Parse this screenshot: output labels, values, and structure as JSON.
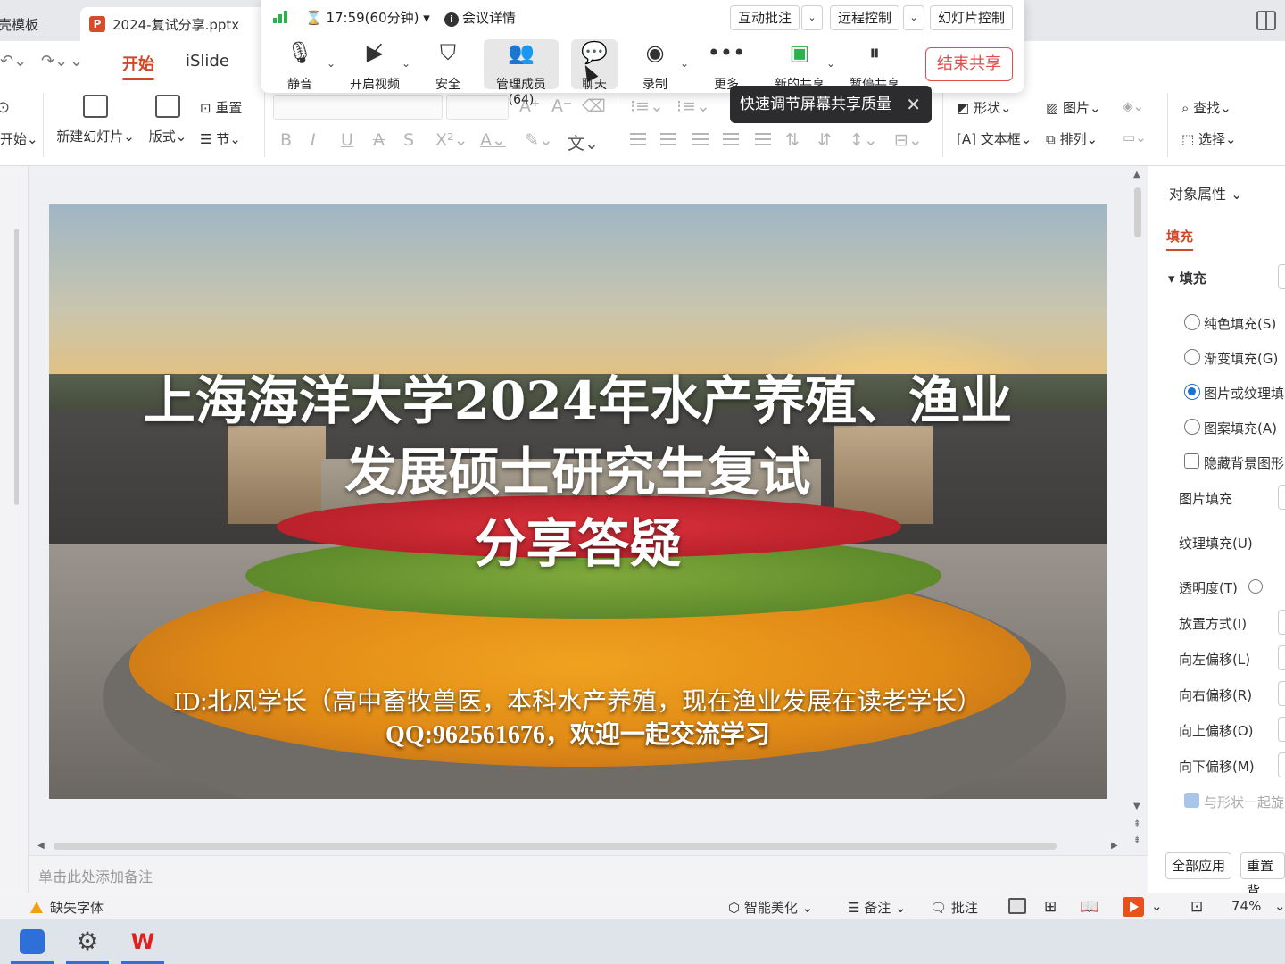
{
  "tabs": [
    {
      "label": "壳模板"
    },
    {
      "label": "2024-复试分享.pptx",
      "badge": "P"
    }
  ],
  "menu": {
    "start": "开始",
    "islide": "iSlide"
  },
  "ribbon": {
    "reset_slide": "重置",
    "start_dropdown": "开始",
    "new_slide": "新建幻灯片",
    "layout": "版式",
    "section": "节",
    "shape": "形状",
    "picture": "图片",
    "textbox": "文本框",
    "arrange": "排列",
    "find": "查找",
    "select": "选择"
  },
  "meeting": {
    "time": "17:59(60分钟)",
    "info": "会议详情",
    "interactive_annotation": "互动批注",
    "remote_control": "远程控制",
    "slide_control": "幻灯片控制",
    "mute": "静音",
    "video": "开启视频",
    "security": "安全",
    "members": "管理成员(64)",
    "chat": "聊天",
    "record": "录制",
    "more": "更多",
    "new_share": "新的共享",
    "pause_share": "暂停共享",
    "end_share": "结束共享",
    "tooltip": "快速调节屏幕共享质量",
    "accent_color": "#2bb24c",
    "end_color": "#e34b4b"
  },
  "slide": {
    "title_line1": "上海海洋大学2024年水产养殖、渔业",
    "title_line2": "发展硕士研究生复试",
    "title_line3": "分享答疑",
    "subtitle_line1": "ID:北风学长（高中畜牧兽医，本科水产养殖，现在渔业发展在读老学长）",
    "subtitle_line2": "QQ:962561676，欢迎一起交流学习"
  },
  "notes_placeholder": "单击此处添加备注",
  "panel": {
    "title": "对象属性",
    "tab_fill": "填充",
    "section_fill": "填充",
    "options": [
      {
        "label": "纯色填充(S)",
        "selected": false
      },
      {
        "label": "渐变填充(G)",
        "selected": false
      },
      {
        "label": "图片或纹理填",
        "selected": true
      },
      {
        "label": "图案填充(A)",
        "selected": false
      }
    ],
    "hide_bg": "隐藏背景图形",
    "picture_fill": "图片填充",
    "texture_fill": "纹理填充(U)",
    "transparency": "透明度(T)",
    "placement": "放置方式(I)",
    "offset_left": "向左偏移(L)",
    "offset_right": "向右偏移(R)",
    "offset_up": "向上偏移(O)",
    "offset_down": "向下偏移(M)",
    "rotate_with_shape": "与形状一起旋",
    "apply_all": "全部应用",
    "reset_bg": "重置背"
  },
  "status": {
    "missing_font": "缺失字体",
    "smart_beautify": "智能美化",
    "notes": "备注",
    "comments": "批注",
    "zoom": "74%"
  },
  "colors": {
    "brand": "#d24726",
    "selected_blue": "#1f6fd6"
  }
}
